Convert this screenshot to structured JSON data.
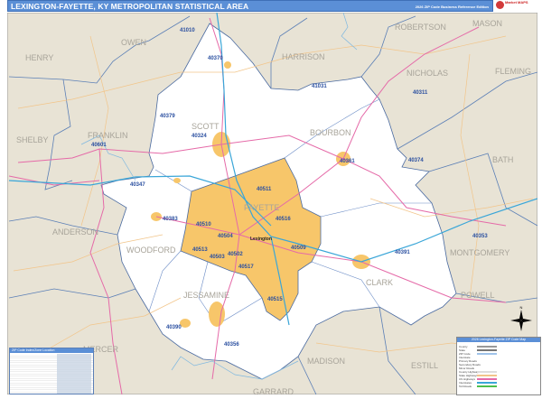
{
  "header": {
    "title": "LEXINGTON-FAYETTE, KY METROPOLITAN STATISTICAL AREA",
    "edition": "2026 ZIP Code Business Reference Edition",
    "logo_text": "Market MAPS"
  },
  "colors": {
    "header": "#5b8fd6",
    "background_counties": "#e8e3d5",
    "msa_counties": "#ffffff",
    "core_county": "#f7c66a",
    "interstate": "#3aa6d8",
    "us_highway": "#e56aa8",
    "state_road": "#f2c58a",
    "county_border": "#5b7fb6"
  },
  "counties": [
    "HENRY",
    "OWEN",
    "HARRISON",
    "ROBERTSON",
    "MASON",
    "NICHOLAS",
    "FLEMING",
    "SHELBY",
    "FRANKLIN",
    "SCOTT",
    "BOURBON",
    "BATH",
    "ANDERSON",
    "WOODFORD",
    "FAYETTE",
    "MONTGOMERY",
    "CLARK",
    "JESSAMINE",
    "MERCER",
    "POWELL",
    "MADISON",
    "ESTILL",
    "GARRARD"
  ],
  "zip_codes": [
    "41010",
    "40370",
    "41031",
    "40311",
    "40379",
    "40324",
    "40601",
    "40361",
    "40374",
    "40347",
    "40511",
    "40383",
    "40516",
    "40510",
    "40504",
    "40509",
    "40513",
    "40517",
    "40391",
    "40353",
    "40515",
    "40390",
    "40356",
    "40502",
    "40503"
  ],
  "city_label": "Lexington",
  "zip_table": {
    "title": "ZIP Code Index/Zone Location"
  },
  "legend": {
    "title": "2026 Lexington-Fayette ZIP Code Map",
    "items": [
      "County",
      "State",
      "ZIP Code",
      "Interstate",
      "Primary Roads",
      "Secondary Roads",
      "Minor Roads",
      "County Highways",
      "State Highways",
      "US Highways",
      "Interstates",
      "Toll Roads"
    ]
  },
  "compass": {
    "label": "N"
  }
}
